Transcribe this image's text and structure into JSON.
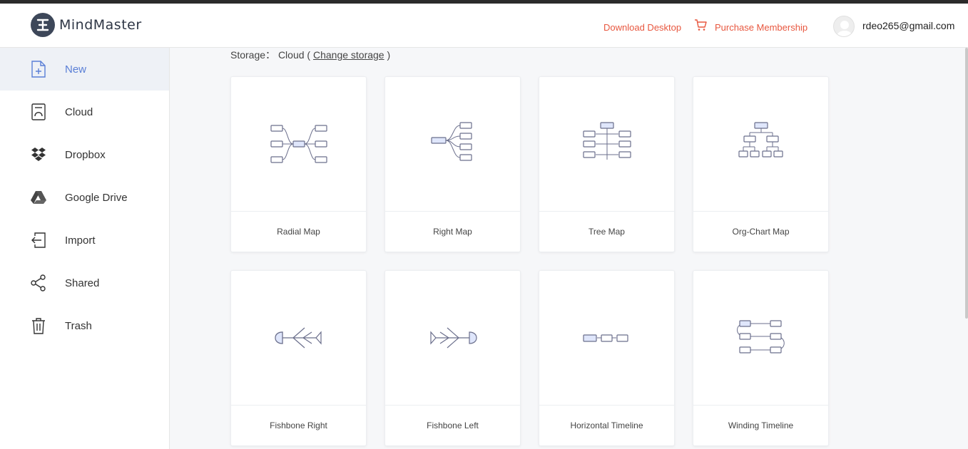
{
  "app": {
    "name": "MindMaster"
  },
  "header": {
    "download_label": "Download Desktop",
    "purchase_label": "Purchase Membership",
    "user_email": "rdeo265@gmail.com"
  },
  "sidebar": {
    "items": [
      {
        "label": "New",
        "icon": "new-file-icon",
        "active": true
      },
      {
        "label": "Cloud",
        "icon": "cloud-icon"
      },
      {
        "label": "Dropbox",
        "icon": "dropbox-icon"
      },
      {
        "label": "Google Drive",
        "icon": "google-drive-icon"
      },
      {
        "label": "Import",
        "icon": "import-icon"
      },
      {
        "label": "Shared",
        "icon": "share-icon"
      },
      {
        "label": "Trash",
        "icon": "trash-icon"
      }
    ]
  },
  "storage": {
    "label": "Storage：",
    "value": "Cloud (",
    "change_link": "Change storage",
    "close": ")"
  },
  "templates": [
    {
      "title": "Radial Map"
    },
    {
      "title": "Right Map"
    },
    {
      "title": "Tree Map"
    },
    {
      "title": "Org-Chart Map"
    },
    {
      "title": "Fishbone Right"
    },
    {
      "title": "Fishbone Left"
    },
    {
      "title": "Horizontal Timeline"
    },
    {
      "title": "Winding Timeline"
    }
  ],
  "colors": {
    "accent": "#5a7fd6",
    "link": "#e8573f",
    "node_fill": "#dfe6fb",
    "node_stroke": "#6b6f8c"
  }
}
